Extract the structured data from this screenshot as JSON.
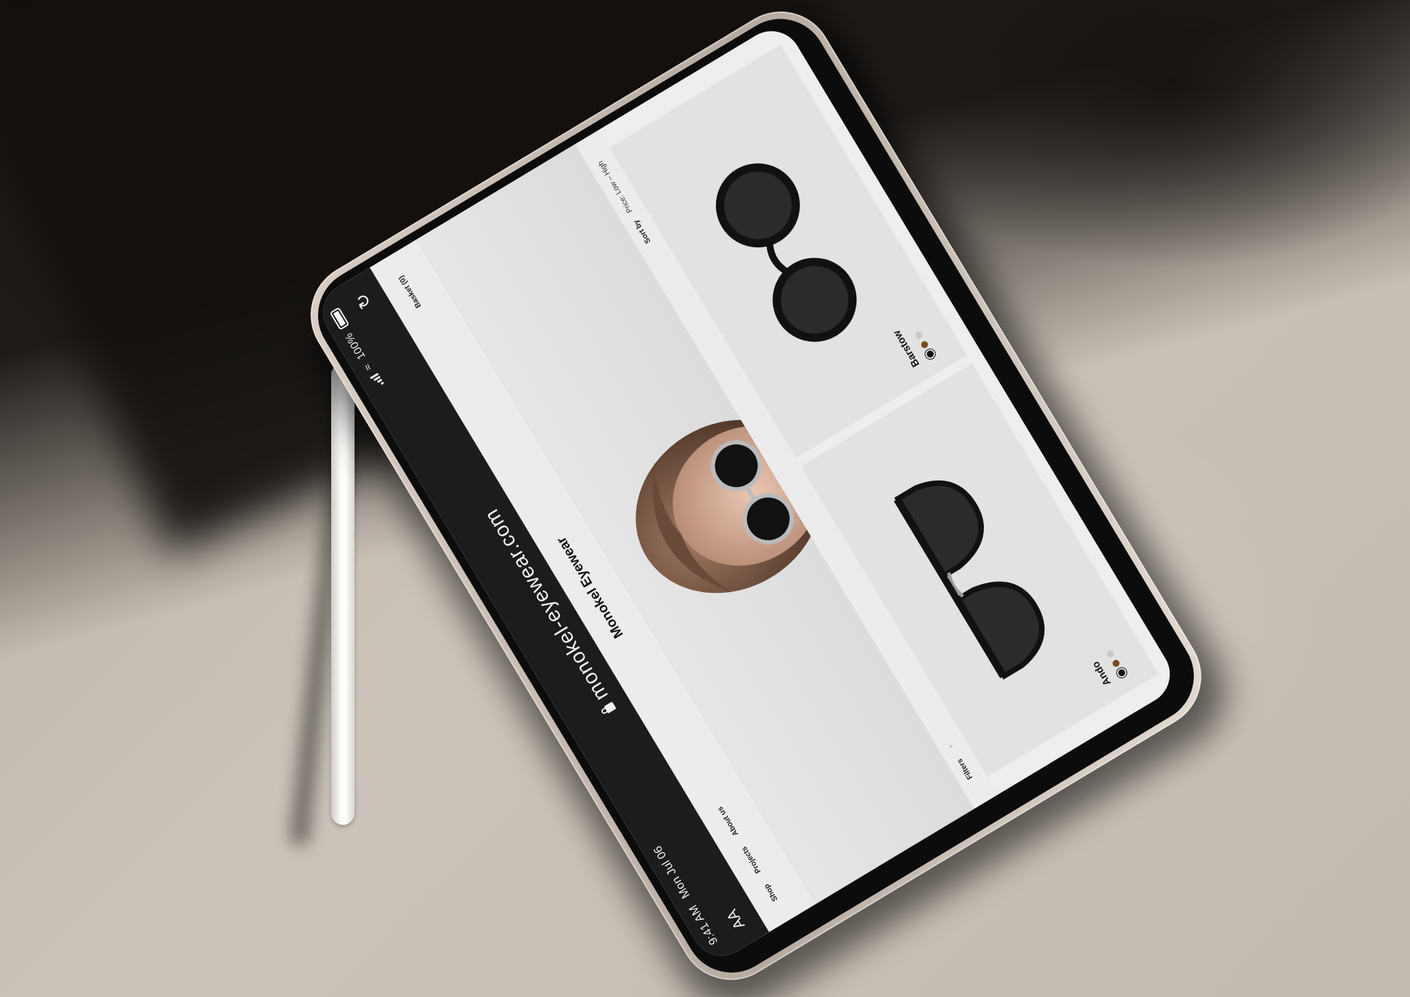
{
  "status_bar": {
    "time": "9:41 AM",
    "date": "Mon Jul 06",
    "battery": "100%"
  },
  "browser": {
    "text_size_label": "AA",
    "url": "monokel-eyewear.com",
    "icons": [
      "lock-icon",
      "reload-icon",
      "signal-icon",
      "wifi-icon",
      "battery-icon"
    ]
  },
  "site": {
    "brand": "Monokel Eyewear",
    "nav": [
      "Shop",
      "Projects",
      "About us"
    ],
    "basket": "Basket (0)",
    "filters_label": "Filters",
    "filters_value": "+",
    "sort_label": "Sort by",
    "sort_value": "Price: Low – High"
  },
  "products": [
    {
      "name": "Ando",
      "swatches": [
        "#111111",
        "#7a4a1c",
        "#c8c8c8"
      ]
    },
    {
      "name": "Barstow",
      "swatches": [
        "#111111",
        "#7a4a1c",
        "#c8c8c8"
      ]
    }
  ],
  "colors": {
    "browser_chrome": "#1c1c1e",
    "page_background": "#eeeeee",
    "card_background": "#e2e2e2"
  }
}
